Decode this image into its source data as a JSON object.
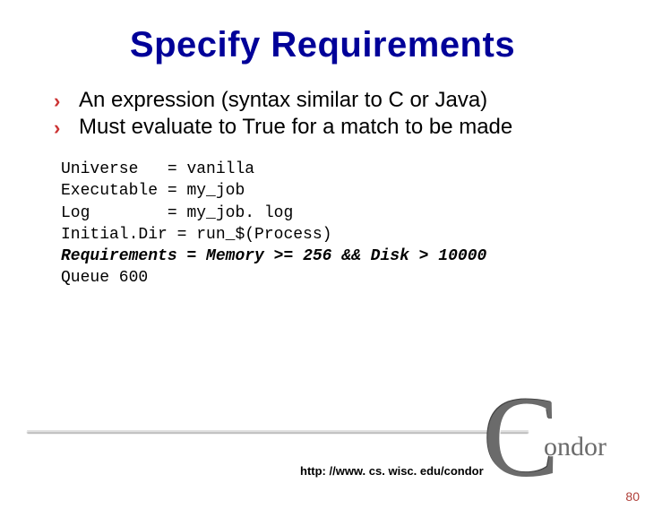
{
  "title": "Specify Requirements",
  "bullets": [
    "An expression (syntax similar to C or Java)",
    "Must evaluate to True for a match to be made"
  ],
  "code": {
    "lines": [
      {
        "key": "Universe   ",
        "eq": "= ",
        "val": "vanilla",
        "em": false
      },
      {
        "key": "Executable ",
        "eq": "= ",
        "val": "my_job",
        "em": false
      },
      {
        "key": "Log        ",
        "eq": "= ",
        "val": "my_job. log",
        "em": false
      },
      {
        "key": "Initial.Dir ",
        "eq": "= ",
        "val": "run_$(Process)",
        "em": false
      },
      {
        "key": "Requirements ",
        "eq": "= ",
        "val": "Memory >= 256 && Disk > 10000",
        "em": true
      },
      {
        "key": "Queue 600",
        "eq": "",
        "val": "",
        "em": false
      }
    ]
  },
  "footer_url": "http: //www. cs. wisc. edu/condor",
  "page_number": "80",
  "logo": {
    "bigC": "C",
    "rest": "ondor"
  }
}
